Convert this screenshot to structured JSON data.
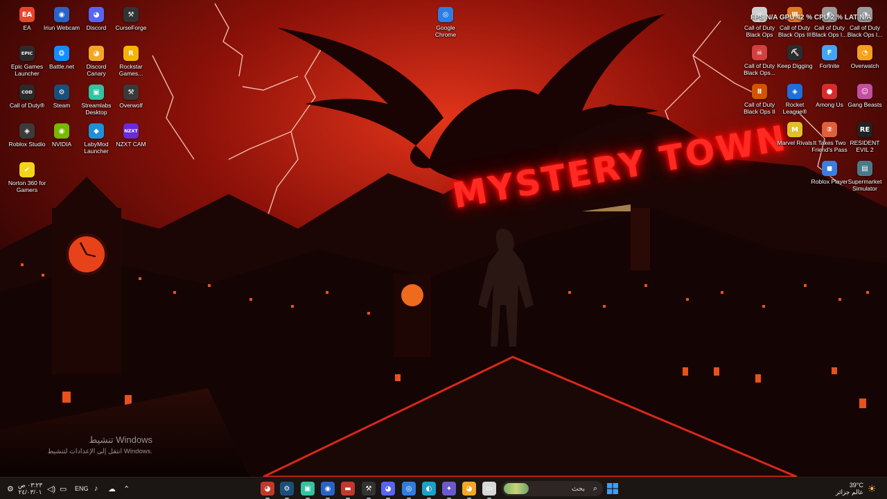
{
  "desktop": {
    "icons_left": [
      {
        "id": "ea",
        "label": "EA",
        "glyph": "EA",
        "color": "#e8452c"
      },
      {
        "id": "iriun",
        "label": "Iriun Webcam",
        "glyph": "◉",
        "color": "#2a63c8"
      },
      {
        "id": "discord",
        "label": "Discord",
        "glyph": "◕",
        "color": "#5865f2"
      },
      {
        "id": "curseforge",
        "label": "CurseForge",
        "glyph": "⚒",
        "color": "#333333"
      },
      {
        "id": "epic",
        "label": "Epic Games Launcher",
        "glyph": "EPIC",
        "color": "#2b2b2b"
      },
      {
        "id": "battlenet",
        "label": "Battle.net",
        "glyph": "❂",
        "color": "#148eff"
      },
      {
        "id": "discord-canary",
        "label": "Discord Canary",
        "glyph": "◕",
        "color": "#f5a623"
      },
      {
        "id": "rockstar",
        "label": "Rockstar Games...",
        "glyph": "R",
        "color": "#f4b400"
      },
      {
        "id": "cod",
        "label": "Call of Duty®",
        "glyph": "COD",
        "color": "#2a2a2a"
      },
      {
        "id": "steam",
        "label": "Steam",
        "glyph": "⚙",
        "color": "#1b4f7a"
      },
      {
        "id": "streamlabs",
        "label": "Streamlabs Desktop",
        "glyph": "▣",
        "color": "#31c3a2"
      },
      {
        "id": "overwolf",
        "label": "Overwolf",
        "glyph": "⚒",
        "color": "#3a3a3a"
      },
      {
        "id": "roblox-studio",
        "label": "Roblox Studio",
        "glyph": "◈",
        "color": "#3b3b3b"
      },
      {
        "id": "nvidia",
        "label": "NVIDIA",
        "glyph": "◉",
        "color": "#76b900"
      },
      {
        "id": "labymod",
        "label": "LabyMod Launcher",
        "glyph": "◆",
        "color": "#1f8fd8"
      },
      {
        "id": "nzxt",
        "label": "NZXT CAM",
        "glyph": "NZXT",
        "color": "#6a2bd8"
      },
      {
        "id": "norton",
        "label": "Norton 360 for Gamers",
        "glyph": "✔",
        "color": "#f2d41a"
      }
    ],
    "icons_chrome": {
      "id": "chrome",
      "label": "Google Chrome",
      "glyph": "◎",
      "color": "#2f7de1"
    },
    "icons_right": [
      {
        "id": "cod-bo",
        "label": "Call of Duty Black Ops",
        "glyph": "☠",
        "color": "#cfcfcf"
      },
      {
        "id": "cod-bo3",
        "label": "Call of Duty Black Ops III",
        "glyph": "Ⅲ",
        "color": "#e07a20"
      },
      {
        "id": "cod-bo-a",
        "label": "Call of Duty Black Ops I...",
        "glyph": "◐",
        "color": "#9a9a9a"
      },
      {
        "id": "cod-bo-b",
        "label": "Call of Duty Black Ops I...",
        "glyph": "◑",
        "color": "#9a9a9a"
      },
      {
        "id": "cod-bo-c",
        "label": "Call of Duty Black Ops...",
        "glyph": "☠",
        "color": "#d24040"
      },
      {
        "id": "keep-digging",
        "label": "Keep Digging",
        "glyph": "⛏",
        "color": "#2c2c2c"
      },
      {
        "id": "fortnite",
        "label": "Fortnite",
        "glyph": "F",
        "color": "#42a5f5"
      },
      {
        "id": "overwatch",
        "label": "Overwatch",
        "glyph": "◔",
        "color": "#f4a11d"
      },
      {
        "id": "cod-bo2",
        "label": "Call of Duty Black Ops II",
        "glyph": "Ⅱ",
        "color": "#d35400"
      },
      {
        "id": "rocket-league",
        "label": "Rocket League®",
        "glyph": "◈",
        "color": "#1e6fd9"
      },
      {
        "id": "among-us",
        "label": "Among Us",
        "glyph": "●",
        "color": "#d92b2b"
      },
      {
        "id": "gang-beasts",
        "label": "Gang Beasts",
        "glyph": "☺",
        "color": "#c24fa0"
      },
      {
        "id": "marvel-rivals",
        "label": "Marvel Rivals",
        "glyph": "M",
        "color": "#e0c02a"
      },
      {
        "id": "it-takes-two",
        "label": "It Takes Two Friend's Pass",
        "glyph": "②",
        "color": "#e0603a"
      },
      {
        "id": "resident-evil",
        "label": "RESIDENT EVIL 2",
        "glyph": "RE",
        "color": "#222222"
      },
      {
        "id": "roblox-player",
        "label": "Roblox Player",
        "glyph": "◼",
        "color": "#3b7de0"
      },
      {
        "id": "supermarket",
        "label": "Supermarket Simulator",
        "glyph": "▤",
        "color": "#4a7a8a"
      }
    ],
    "wallpaper_title": "MYSTERY TOWN",
    "perf_overlay": "FPS N/A GPU 42 % CPU 2 % LAT N/A",
    "activation": {
      "line1": "تنشيط Windows",
      "line2": "انتقل إلى الإعدادات لتنشيط Windows."
    }
  },
  "taskbar": {
    "clock_time": "٠٣:٢٣ ص",
    "clock_date": "٢٤/٠٣/٠١",
    "language": "ENG",
    "search_placeholder": "بحث",
    "weather_temp": "39°C",
    "weather_text": "عالم جزائر",
    "apps": [
      {
        "id": "app-1",
        "glyph": "◕",
        "color": "#c0392b"
      },
      {
        "id": "app-steam",
        "glyph": "⚙",
        "color": "#1b4f7a"
      },
      {
        "id": "app-streamlabs",
        "glyph": "▣",
        "color": "#31c3a2"
      },
      {
        "id": "app-iriun",
        "glyph": "◉",
        "color": "#2a63c8"
      },
      {
        "id": "app-game",
        "glyph": "▬",
        "color": "#c0392b"
      },
      {
        "id": "app-curseforge",
        "glyph": "⚒",
        "color": "#333333"
      },
      {
        "id": "app-discord",
        "glyph": "◕",
        "color": "#5865f2"
      },
      {
        "id": "app-chrome",
        "glyph": "◎",
        "color": "#2f7de1"
      },
      {
        "id": "app-edge",
        "glyph": "◐",
        "color": "#1aa3c8"
      },
      {
        "id": "app-copilot",
        "glyph": "✦",
        "color": "#6a5acd"
      },
      {
        "id": "app-discord-canary",
        "glyph": "◕",
        "color": "#f5a623"
      },
      {
        "id": "app-explorer",
        "glyph": "▭",
        "color": "#d8d8d8"
      }
    ]
  }
}
